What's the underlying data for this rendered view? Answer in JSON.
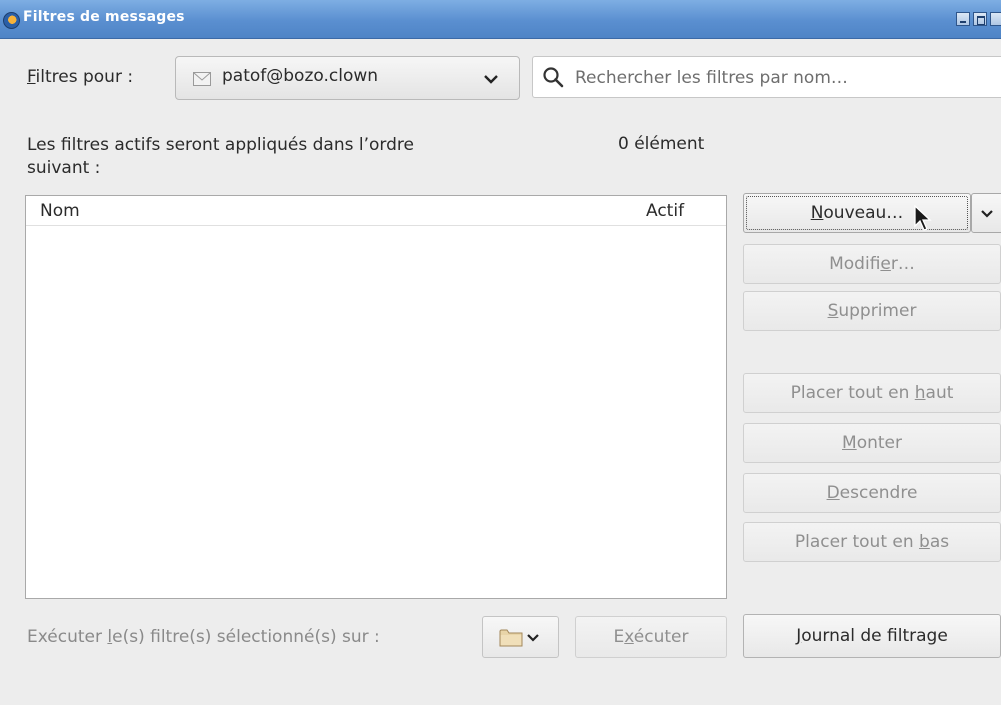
{
  "window": {
    "title": "Filtres de messages",
    "icons": {
      "app": "thunderbird-icon",
      "minimize": "minimize-icon",
      "maximize": "maximize-icon",
      "close": "close-icon"
    }
  },
  "filters_for": {
    "label_mnemonic": "F",
    "label_rest": "iltres pour :",
    "account": "patof@bozo.clown",
    "account_icon": "envelope-icon",
    "dropdown_icon": "chevron-down-icon"
  },
  "search": {
    "placeholder": "Rechercher les filtres par nom…",
    "icon": "search-icon"
  },
  "list_info": {
    "description_line1": "Les filtres actifs seront appliqués dans l’ordre",
    "description_line2": "suivant :",
    "count": "0 élément"
  },
  "list": {
    "columns": [
      "Nom",
      "Actif"
    ],
    "rows": []
  },
  "buttons": {
    "new": {
      "mnemonic": "N",
      "rest": "ouveau…"
    },
    "edit": {
      "before": "Modifi",
      "mnemonic": "e",
      "after": "r…"
    },
    "delete": {
      "mnemonic": "S",
      "rest": "upprimer"
    },
    "move_top": {
      "before": "Placer tout en ",
      "mnemonic": "h",
      "after": "aut"
    },
    "move_up": {
      "mnemonic": "M",
      "rest": "onter"
    },
    "move_down": {
      "mnemonic": "D",
      "rest": "escendre"
    },
    "move_bottom": {
      "before": "Placer tout en ",
      "mnemonic": "b",
      "after": "as"
    },
    "log": {
      "mnemonic": "J",
      "rest": "ournal de filtrage"
    }
  },
  "run": {
    "label_before": "Exécuter ",
    "label_mnemonic": "l",
    "label_after": "e(s) filtre(s) sélectionné(s) sur :",
    "folder_icon": "folder-icon",
    "button_before": "E",
    "button_mnemonic": "x",
    "button_after": "écuter"
  },
  "colors": {
    "titlebar": "#5a8fd0",
    "window_bg": "#ededed",
    "disabled_text": "#8f8f8f"
  }
}
